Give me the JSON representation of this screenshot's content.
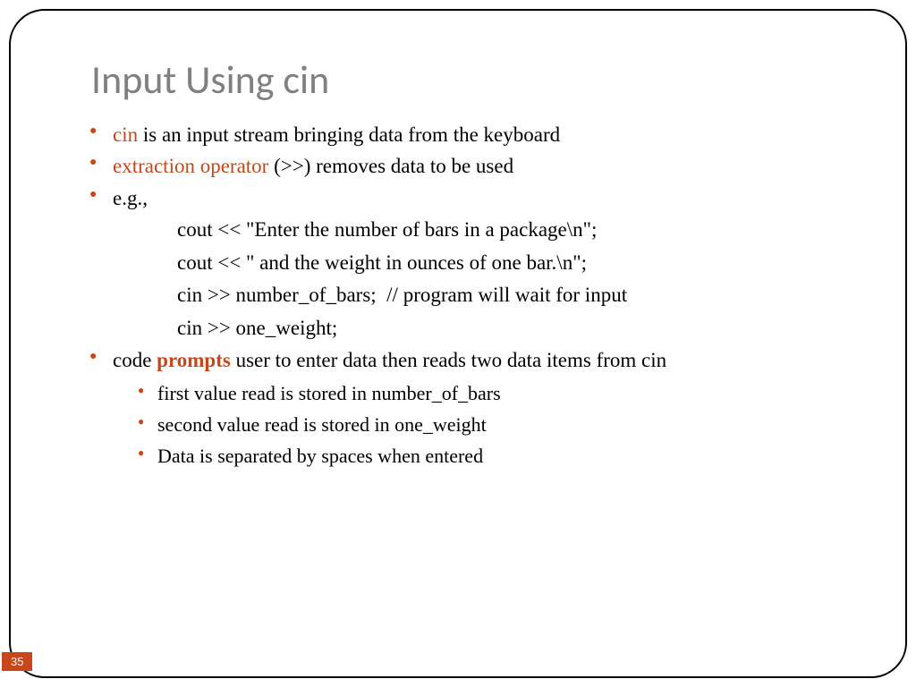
{
  "title": "Input Using cin",
  "bullets": {
    "b1": {
      "kw": "cin",
      "rest": " is an input stream bringing data from the keyboard"
    },
    "b2": {
      "kw": "extraction operator",
      "rest": " (>>) removes data to be used"
    },
    "b3": {
      "label": "e.g.,"
    },
    "code": {
      "l1": "cout << \"Enter the number of bars in a package\\n\";",
      "l2": "cout << \" and the weight in ounces of one bar.\\n\";",
      "l3": "cin >> number_of_bars;  // program will wait for input",
      "l4": "cin >> one_weight;"
    },
    "b4": {
      "pre": "code ",
      "kw": "prompts",
      "rest": " user to enter data then reads two data items from cin"
    },
    "sub": {
      "s1": "first value read is stored in number_of_bars",
      "s2": "second value read is stored in one_weight",
      "s3": "Data is separated by spaces when entered"
    }
  },
  "page": "35"
}
